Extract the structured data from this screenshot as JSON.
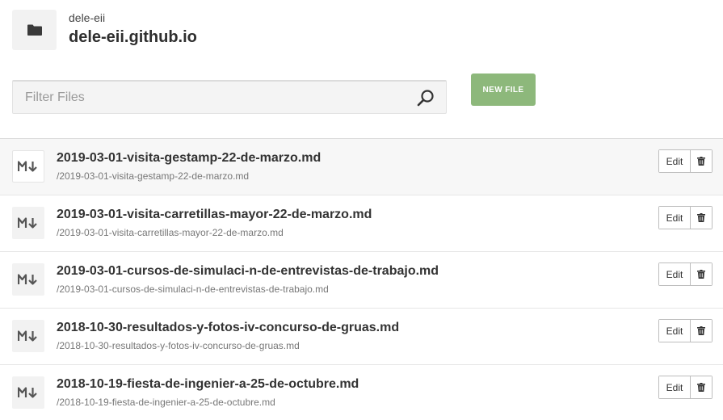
{
  "header": {
    "owner": "dele-eii",
    "repo": "dele-eii.github.io",
    "icon": "folder-icon"
  },
  "filter": {
    "placeholder": "Filter Files",
    "value": "",
    "icon": "search-icon"
  },
  "actions": {
    "new_file_label": "NEW FILE"
  },
  "files": [
    {
      "name": "2019-03-01-visita-gestamp-22-de-marzo.md",
      "path": "/2019-03-01-visita-gestamp-22-de-marzo.md",
      "edit_label": "Edit"
    },
    {
      "name": "2019-03-01-visita-carretillas-mayor-22-de-marzo.md",
      "path": "/2019-03-01-visita-carretillas-mayor-22-de-marzo.md",
      "edit_label": "Edit"
    },
    {
      "name": "2019-03-01-cursos-de-simulaci-n-de-entrevistas-de-trabajo.md",
      "path": "/2019-03-01-cursos-de-simulaci-n-de-entrevistas-de-trabajo.md",
      "edit_label": "Edit"
    },
    {
      "name": "2018-10-30-resultados-y-fotos-iv-concurso-de-gruas.md",
      "path": "/2018-10-30-resultados-y-fotos-iv-concurso-de-gruas.md",
      "edit_label": "Edit"
    },
    {
      "name": "2018-10-19-fiesta-de-ingenier-a-25-de-octubre.md",
      "path": "/2018-10-19-fiesta-de-ingenier-a-25-de-octubre.md",
      "edit_label": "Edit"
    }
  ],
  "colors": {
    "accent": "#8db87b",
    "text": "#333333",
    "muted": "#777777"
  }
}
